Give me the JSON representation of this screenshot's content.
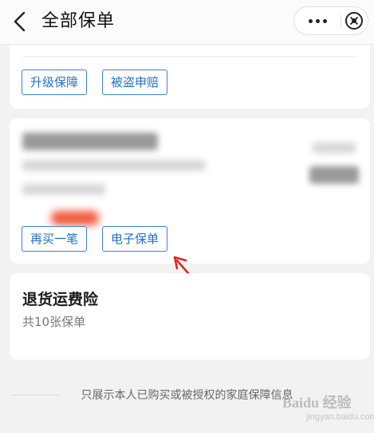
{
  "header": {
    "title": "全部保单"
  },
  "card1": {
    "buttons": [
      "升级保障",
      "被盗申赔"
    ]
  },
  "card2": {
    "buttons": [
      "再买一笔",
      "电子保单"
    ]
  },
  "card3": {
    "name": "退货运费险",
    "count": "共10张保单"
  },
  "footer": {
    "note": "只展示本人已购买或被授权的家庭保障信息"
  },
  "watermark": {
    "main": "Baidu 经验",
    "sub": "jingyan.baidu.com"
  },
  "colors": {
    "accent": "#1f6fd0",
    "arrow": "#e02020",
    "background": "#f2f2f2"
  }
}
